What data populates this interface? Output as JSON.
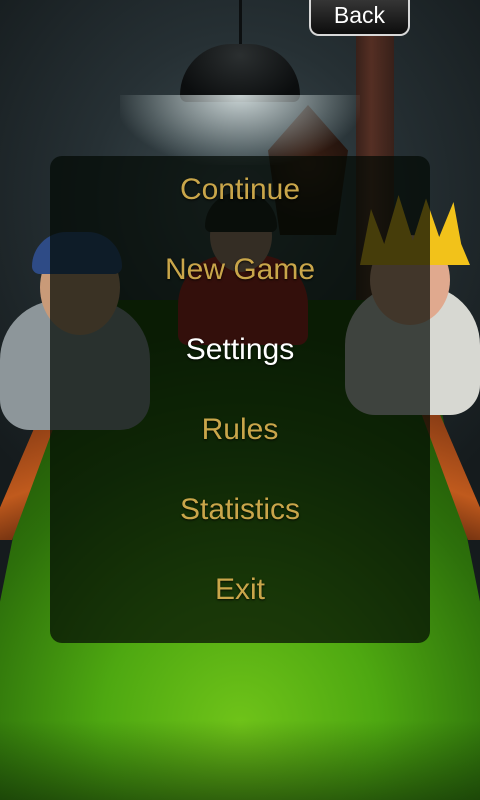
{
  "back_button": {
    "label": "Back"
  },
  "menu": {
    "items": [
      {
        "label": "Continue",
        "active": false
      },
      {
        "label": "New Game",
        "active": false
      },
      {
        "label": "Settings",
        "active": true
      },
      {
        "label": "Rules",
        "active": false
      },
      {
        "label": "Statistics",
        "active": false
      },
      {
        "label": "Exit",
        "active": false
      }
    ]
  },
  "colors": {
    "menu_text": "#c9a64a",
    "menu_text_active": "#ffffff",
    "table_felt": "#5bb512"
  }
}
